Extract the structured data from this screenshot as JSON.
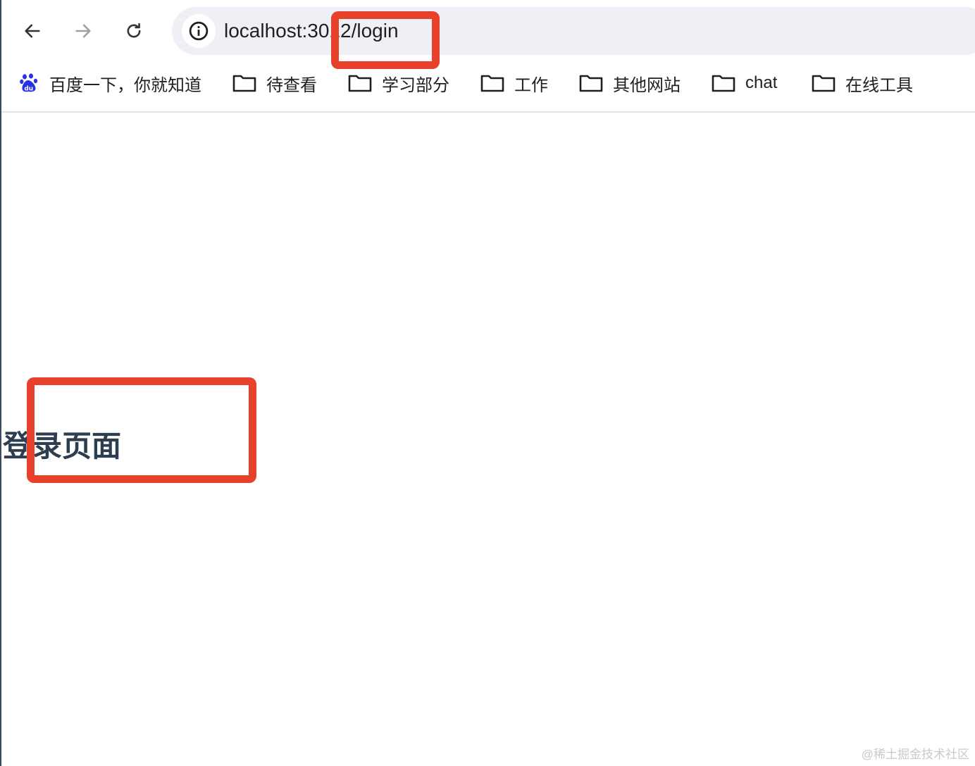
{
  "browser": {
    "address_bar": {
      "url": "localhost:3012/login"
    },
    "bookmarks": [
      {
        "label": "百度一下，你就知道",
        "icon": "baidu-paw-icon"
      },
      {
        "label": "待查看",
        "icon": "folder-icon"
      },
      {
        "label": "学习部分",
        "icon": "folder-icon"
      },
      {
        "label": "工作",
        "icon": "folder-icon"
      },
      {
        "label": "其他网站",
        "icon": "folder-icon"
      },
      {
        "label": "chat",
        "icon": "folder-icon"
      },
      {
        "label": "在线工具",
        "icon": "folder-icon"
      }
    ]
  },
  "content": {
    "heading": "登录页面"
  },
  "watermark": "@稀土掘金技术社区",
  "colors": {
    "highlight": "#e8412b",
    "heading_text": "#2c3e50",
    "omnibox_bg": "#eef0f5",
    "baidu_blue": "#2932e1"
  }
}
